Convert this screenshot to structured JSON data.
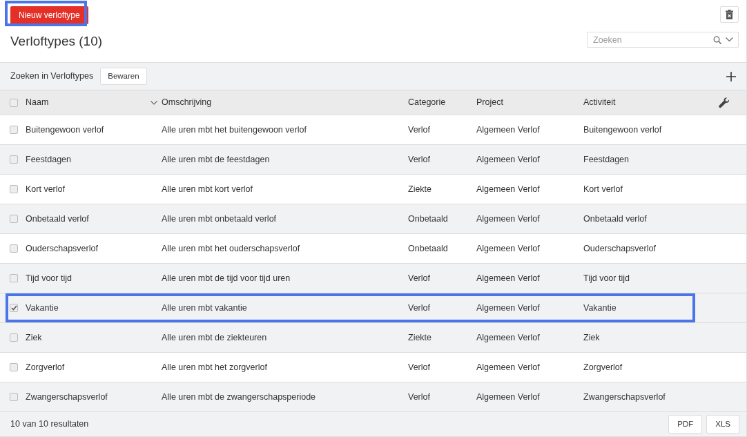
{
  "new_button": {
    "label": "Nieuw verloftype",
    "highlighted": true
  },
  "title": "Verloftypes (10)",
  "search": {
    "placeholder": "Zoeken"
  },
  "toolbar": {
    "label": "Zoeken in Verloftypes",
    "save_button": "Bewaren"
  },
  "table": {
    "select_all": {
      "checked": false
    },
    "columns": [
      {
        "label": "Naam",
        "sorted": true
      },
      {
        "label": "Omschrijving",
        "sorted": false
      },
      {
        "label": "Categorie",
        "sorted": false
      },
      {
        "label": "Project",
        "sorted": false
      },
      {
        "label": "Activiteit",
        "sorted": false
      }
    ],
    "rows": [
      {
        "cells": [
          "Buitengewoon verlof",
          "Alle uren mbt het buitengewoon verlof",
          "Verlof",
          "Algemeen Verlof",
          "Buitengewoon verlof"
        ],
        "checked": false,
        "highlighted": false
      },
      {
        "cells": [
          "Feestdagen",
          "Alle uren mbt de feestdagen",
          "Verlof",
          "Algemeen Verlof",
          "Feestdagen"
        ],
        "checked": false,
        "highlighted": false
      },
      {
        "cells": [
          "Kort verlof",
          "Alle uren mbt kort verlof",
          "Ziekte",
          "Algemeen Verlof",
          "Kort verlof"
        ],
        "checked": false,
        "highlighted": false
      },
      {
        "cells": [
          "Onbetaald verlof",
          "Alle uren mbt onbetaald verlof",
          "Onbetaald",
          "Algemeen Verlof",
          "Onbetaald verlof"
        ],
        "checked": false,
        "highlighted": false
      },
      {
        "cells": [
          "Ouderschapsverlof",
          "Alle uren mbt het ouderschapsverlof",
          "Onbetaald",
          "Algemeen Verlof",
          "Ouderschapsverlof"
        ],
        "checked": false,
        "highlighted": false
      },
      {
        "cells": [
          "Tijd voor tijd",
          "Alle uren mbt de tijd voor tijd uren",
          "Verlof",
          "Algemeen Verlof",
          "Tijd voor tijd"
        ],
        "checked": false,
        "highlighted": false
      },
      {
        "cells": [
          "Vakantie",
          "Alle uren mbt vakantie",
          "Verlof",
          "Algemeen Verlof",
          "Vakantie"
        ],
        "checked": true,
        "highlighted": true
      },
      {
        "cells": [
          "Ziek",
          "Alle uren mbt de ziekteuren",
          "Ziekte",
          "Algemeen Verlof",
          "Ziek"
        ],
        "checked": false,
        "highlighted": false
      },
      {
        "cells": [
          "Zorgverlof",
          "Alle uren mbt het zorgverlof",
          "Verlof",
          "Algemeen Verlof",
          "Zorgverlof"
        ],
        "checked": false,
        "highlighted": false
      },
      {
        "cells": [
          "Zwangerschapsverlof",
          "Alle uren mbt de zwangerschapsperiode",
          "Verlof",
          "Algemeen Verlof",
          "Zwangerschapsverlof"
        ],
        "checked": false,
        "highlighted": false
      }
    ]
  },
  "footer": {
    "result_count": "10 van 10 resultaten",
    "export_buttons": [
      "PDF",
      "XLS"
    ]
  }
}
